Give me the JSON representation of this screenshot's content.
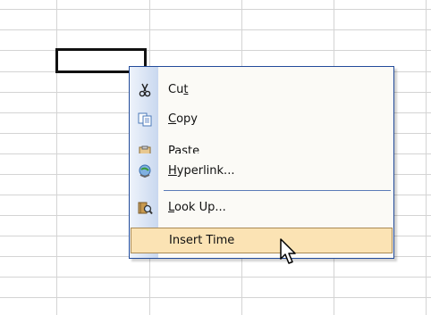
{
  "spreadsheet": {
    "grid_color": "#d4d4d4",
    "selection_border_color": "#111111"
  },
  "context_menu": {
    "items": [
      {
        "label_plain": "Cu",
        "label_ul": "t",
        "label_rest": "",
        "icon": "scissors-icon"
      },
      {
        "label_plain": "",
        "label_ul": "C",
        "label_rest": "opy",
        "icon": "copy-icon"
      },
      {
        "label_plain": "",
        "label_ul": "",
        "label_rest": "Paste",
        "icon": "paste-icon"
      },
      {
        "label_plain": "",
        "label_ul": "H",
        "label_rest": "yperlink...",
        "icon": "hyperlink-icon"
      },
      {
        "label_plain": "",
        "label_ul": "L",
        "label_rest": "ook Up...",
        "icon": "look-up-icon"
      },
      {
        "label_plain": "Insert Time",
        "label_ul": "",
        "label_rest": "",
        "icon": ""
      }
    ],
    "colors": {
      "border": "#224b9a",
      "highlight": "#fbe3b4",
      "highlight_border": "#a98a55"
    }
  }
}
